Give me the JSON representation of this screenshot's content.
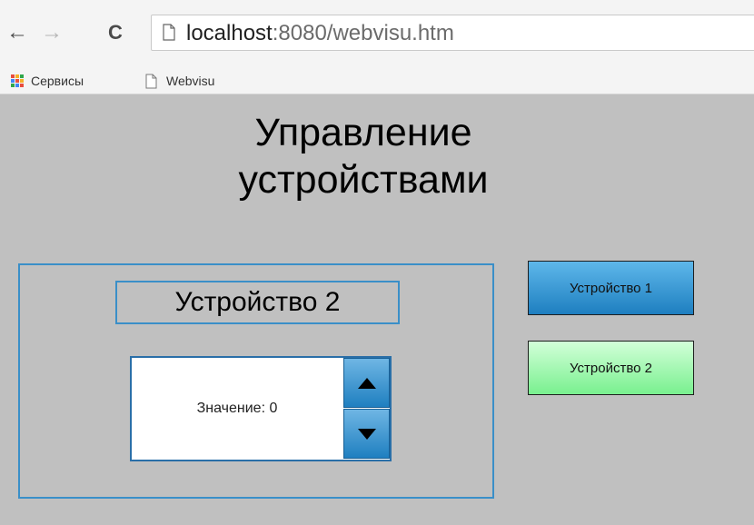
{
  "browser": {
    "url_host": "localhost",
    "url_rest": ":8080/webvisu.htm",
    "bookmarks": [
      {
        "label": "Сервисы",
        "icon": "apps-grid-icon"
      },
      {
        "label": "Webvisu",
        "icon": "page-icon"
      }
    ],
    "apps_colors": [
      "#e84c3d",
      "#f6b026",
      "#2fa64a",
      "#4285f4",
      "#e84c3d",
      "#f6b026",
      "#2fa64a",
      "#4285f4",
      "#e84c3d"
    ]
  },
  "page": {
    "title": "Управление устройствами",
    "device_panel": {
      "device_label": "Устройство 2",
      "value_text": "Значение: 0"
    },
    "buttons": [
      {
        "label": "Устройство 1",
        "color": "#1e7fc0"
      },
      {
        "label": "Устройство 2",
        "color": "#79f08f"
      }
    ]
  },
  "colors": {
    "background": "#c0c0c0",
    "accent_border": "#3a8fc8"
  }
}
